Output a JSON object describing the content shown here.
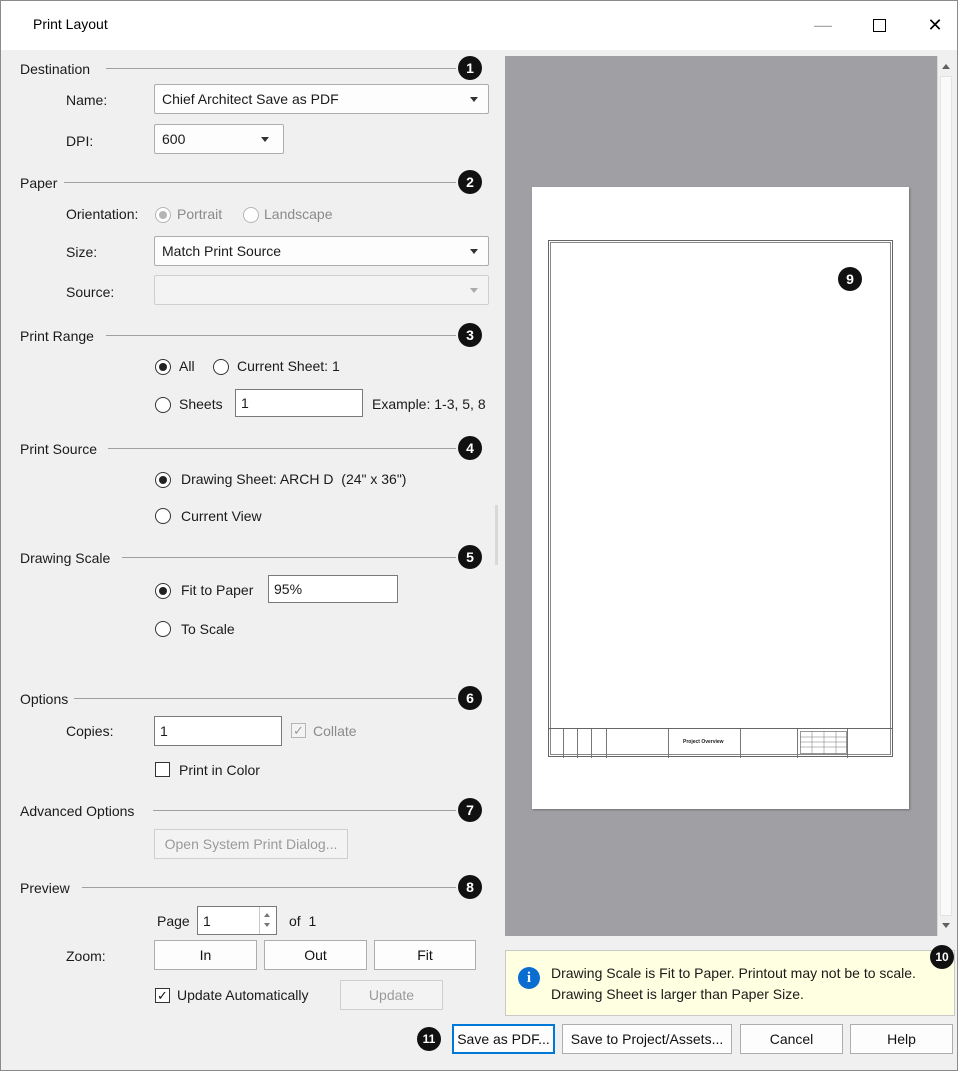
{
  "window": {
    "title": "Print Layout",
    "min_glyph": "—",
    "close_glyph": "✕"
  },
  "callouts": [
    "1",
    "2",
    "3",
    "4",
    "5",
    "6",
    "7",
    "8",
    "9",
    "10",
    "11"
  ],
  "destination": {
    "section": "Destination",
    "name_label": "Name:",
    "name_value": "Chief Architect Save as PDF",
    "dpi_label": "DPI:",
    "dpi_value": "600"
  },
  "paper": {
    "section": "Paper",
    "orientation_label": "Orientation:",
    "portrait": "Portrait",
    "landscape": "Landscape",
    "size_label": "Size:",
    "size_value": "Match Print Source",
    "source_label": "Source:",
    "source_value": ""
  },
  "print_range": {
    "section": "Print Range",
    "all": "All",
    "current_sheet": "Current Sheet: 1",
    "sheets": "Sheets",
    "sheets_value": "1",
    "example": "Example: 1-3, 5, 8"
  },
  "print_source": {
    "section": "Print Source",
    "drawing_sheet": "Drawing Sheet: ARCH D  (24\" x 36\")",
    "current_view": "Current View"
  },
  "drawing_scale": {
    "section": "Drawing Scale",
    "fit_to_paper": "Fit to Paper",
    "fit_value": "95%",
    "to_scale": "To Scale"
  },
  "options": {
    "section": "Options",
    "copies_label": "Copies:",
    "copies_value": "1",
    "collate": "Collate",
    "print_in_color": "Print in Color"
  },
  "advanced": {
    "section": "Advanced Options",
    "open_system_dialog": "Open System Print Dialog..."
  },
  "preview": {
    "section": "Preview",
    "page_label": "Page",
    "page_value": "1",
    "of_label": "of  1",
    "zoom_label": "Zoom:",
    "in": "In",
    "out": "Out",
    "fit": "Fit",
    "update_automatically": "Update Automatically",
    "update": "Update",
    "sheet_title": "Project Overview"
  },
  "info": {
    "line1": "Drawing Scale is Fit to Paper. Printout may not be to scale.",
    "line2": "Drawing Sheet is larger than Paper Size."
  },
  "footer": {
    "save_pdf": "Save as PDF...",
    "save_project": "Save to Project/Assets...",
    "cancel": "Cancel",
    "help": "Help"
  }
}
